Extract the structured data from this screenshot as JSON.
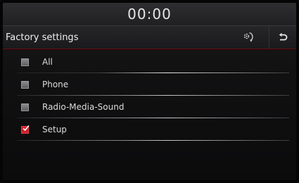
{
  "status": {
    "clock": "00:00"
  },
  "header": {
    "title": "Factory settings",
    "reset_icon": "reset-settings-icon",
    "back_icon": "back-arrow-icon"
  },
  "options": [
    {
      "label": "All",
      "checked": false
    },
    {
      "label": "Phone",
      "checked": false
    },
    {
      "label": "Radio-Media-Sound",
      "checked": false
    },
    {
      "label": "Setup",
      "checked": true
    }
  ],
  "colors": {
    "accent": "#d0202a",
    "background": "#111112",
    "text": "#dcdcdc"
  }
}
